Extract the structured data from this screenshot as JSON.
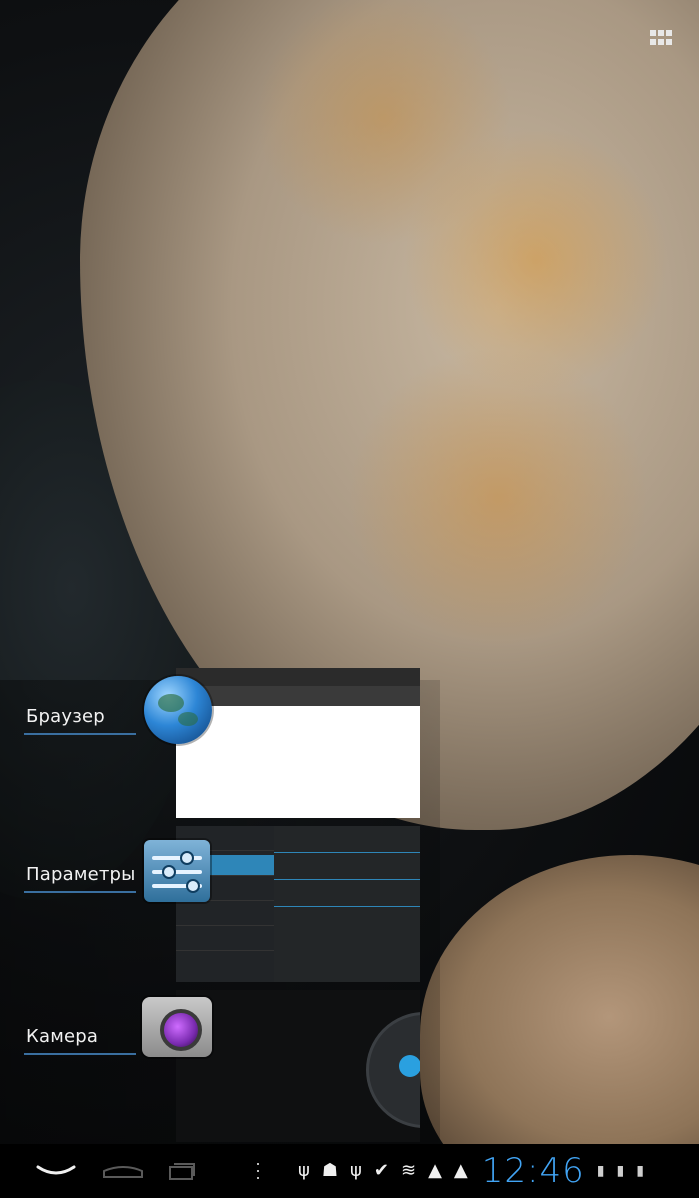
{
  "recent_apps": [
    {
      "label": "Браузер",
      "icon": "globe-icon"
    },
    {
      "label": "Параметры",
      "icon": "settings-sliders-icon"
    },
    {
      "label": "Камера",
      "icon": "camera-icon"
    }
  ],
  "status_bar": {
    "time": "12:46",
    "icons": [
      "usb-icon",
      "android-debug-icon",
      "usb-icon",
      "chat-icon",
      "wifi-icon",
      "warning-icon",
      "warning-icon",
      "sim-icon",
      "sim-icon",
      "battery-icon"
    ]
  },
  "nav_bar": {
    "buttons": [
      "back-button",
      "home-button",
      "recents-button",
      "menu-button"
    ]
  },
  "colors": {
    "clock": "#42a5f5",
    "label_underline": "#3a6fa0",
    "navbar_bg": "#000000"
  }
}
